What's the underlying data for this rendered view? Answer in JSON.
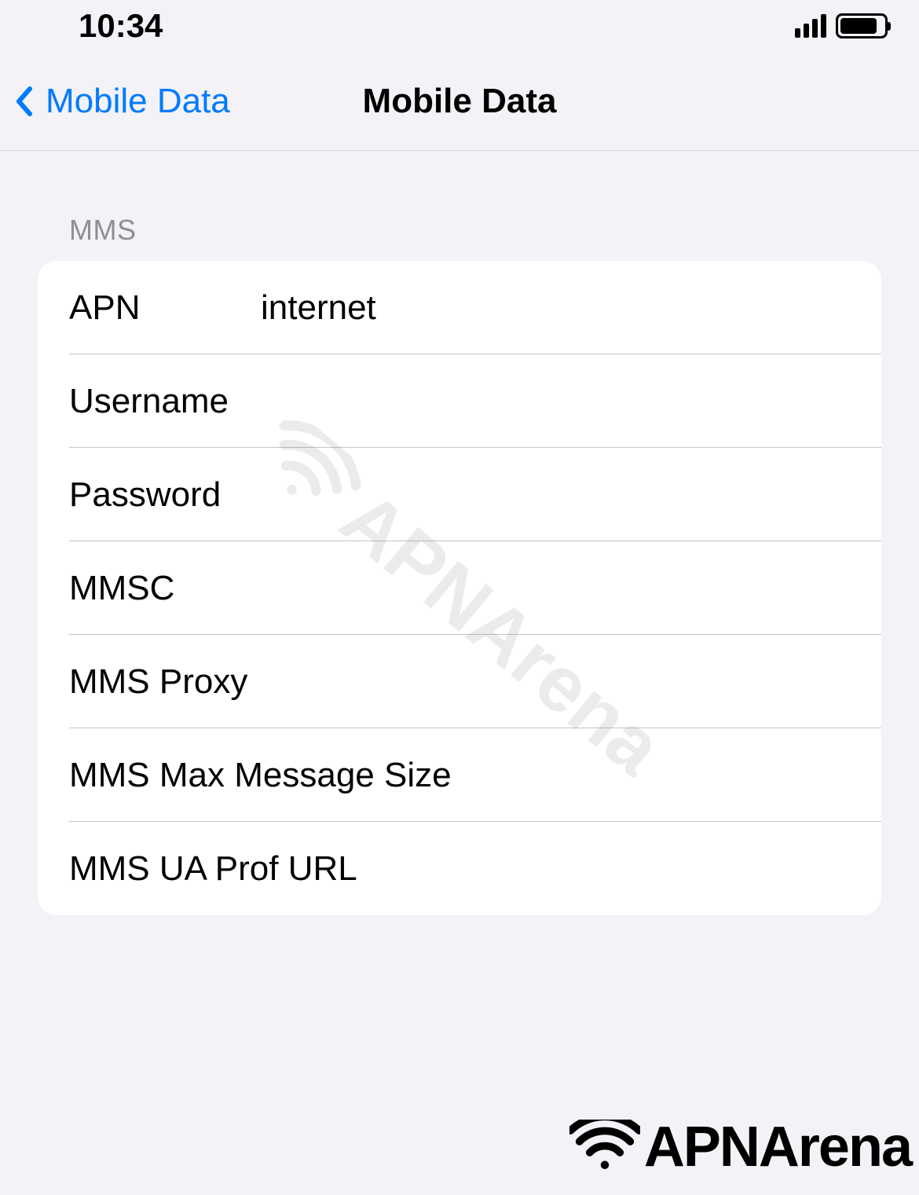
{
  "status_bar": {
    "time": "10:34"
  },
  "nav": {
    "back_label": "Mobile Data",
    "title": "Mobile Data"
  },
  "section": {
    "header": "MMS",
    "rows": [
      {
        "label": "APN",
        "value": "internet"
      },
      {
        "label": "Username",
        "value": ""
      },
      {
        "label": "Password",
        "value": ""
      },
      {
        "label": "MMSC",
        "value": ""
      },
      {
        "label": "MMS Proxy",
        "value": ""
      },
      {
        "label": "MMS Max Message Size",
        "value": ""
      },
      {
        "label": "MMS UA Prof URL",
        "value": ""
      }
    ]
  },
  "watermark": {
    "text": "APNArena"
  },
  "footer": {
    "text": "APNArena"
  }
}
